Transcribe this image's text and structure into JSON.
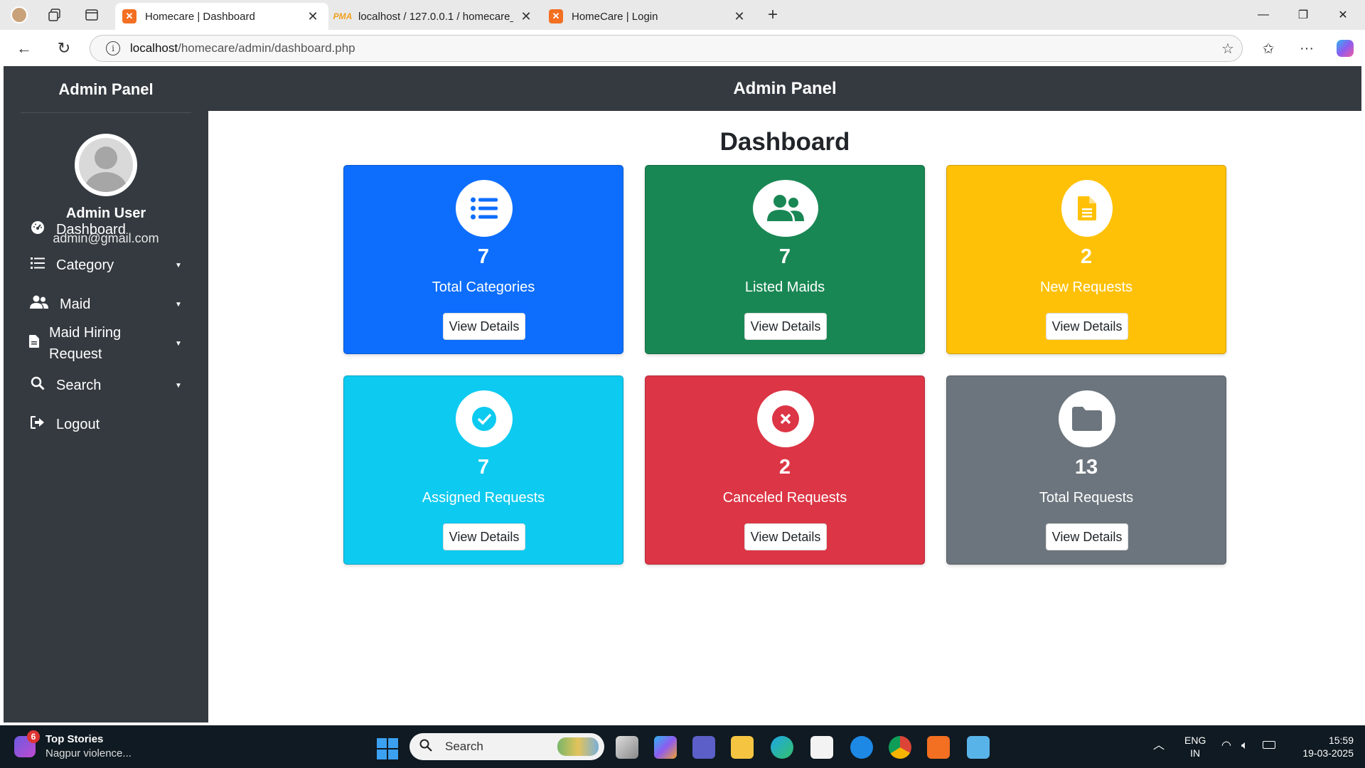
{
  "browser": {
    "tabs": [
      {
        "title": "Homecare | Dashboard",
        "active": true
      },
      {
        "title": "localhost / 127.0.0.1 / homecare_d",
        "active": false
      },
      {
        "title": "HomeCare | Login",
        "active": false
      }
    ],
    "url_host": "localhost",
    "url_path": "/homecare/admin/dashboard.php"
  },
  "sidebar": {
    "title": "Admin Panel",
    "user_name": "Admin User",
    "user_email": "admin@gmail.com",
    "items": [
      {
        "label": "Dashboard",
        "icon": "dashboard-gauge-icon"
      },
      {
        "label": "Category",
        "icon": "list-icon"
      },
      {
        "label": "Maid",
        "icon": "users-icon"
      },
      {
        "label": "Maid Hiring Request",
        "icon": "file-icon"
      },
      {
        "label": "Search",
        "icon": "search-icon"
      },
      {
        "label": "Logout",
        "icon": "logout-icon"
      }
    ]
  },
  "header": {
    "title": "Admin Panel"
  },
  "main": {
    "title": "Dashboard",
    "cards": [
      {
        "value": "7",
        "label": "Total Categories",
        "button": "View Details",
        "color": "#0d6efd",
        "icon": "list-icon"
      },
      {
        "value": "7",
        "label": "Listed Maids",
        "button": "View Details",
        "color": "#198754",
        "icon": "users-icon"
      },
      {
        "value": "2",
        "label": "New Requests",
        "button": "View Details",
        "color": "#ffc107",
        "icon": "file-icon"
      },
      {
        "value": "7",
        "label": "Assigned Requests",
        "button": "View Details",
        "color": "#0dcaf0",
        "icon": "check-circle-icon"
      },
      {
        "value": "2",
        "label": "Canceled Requests",
        "button": "View Details",
        "color": "#dc3545",
        "icon": "x-circle-icon"
      },
      {
        "value": "13",
        "label": "Total Requests",
        "button": "View Details",
        "color": "#6c757d",
        "icon": "folder-icon"
      }
    ]
  },
  "taskbar": {
    "news_title": "Top Stories",
    "news_sub": "Nagpur violence...",
    "news_badge": "6",
    "search_placeholder": "Search",
    "lang": "ENG",
    "region": "IN",
    "time": "15:59",
    "date": "19-03-2025"
  }
}
